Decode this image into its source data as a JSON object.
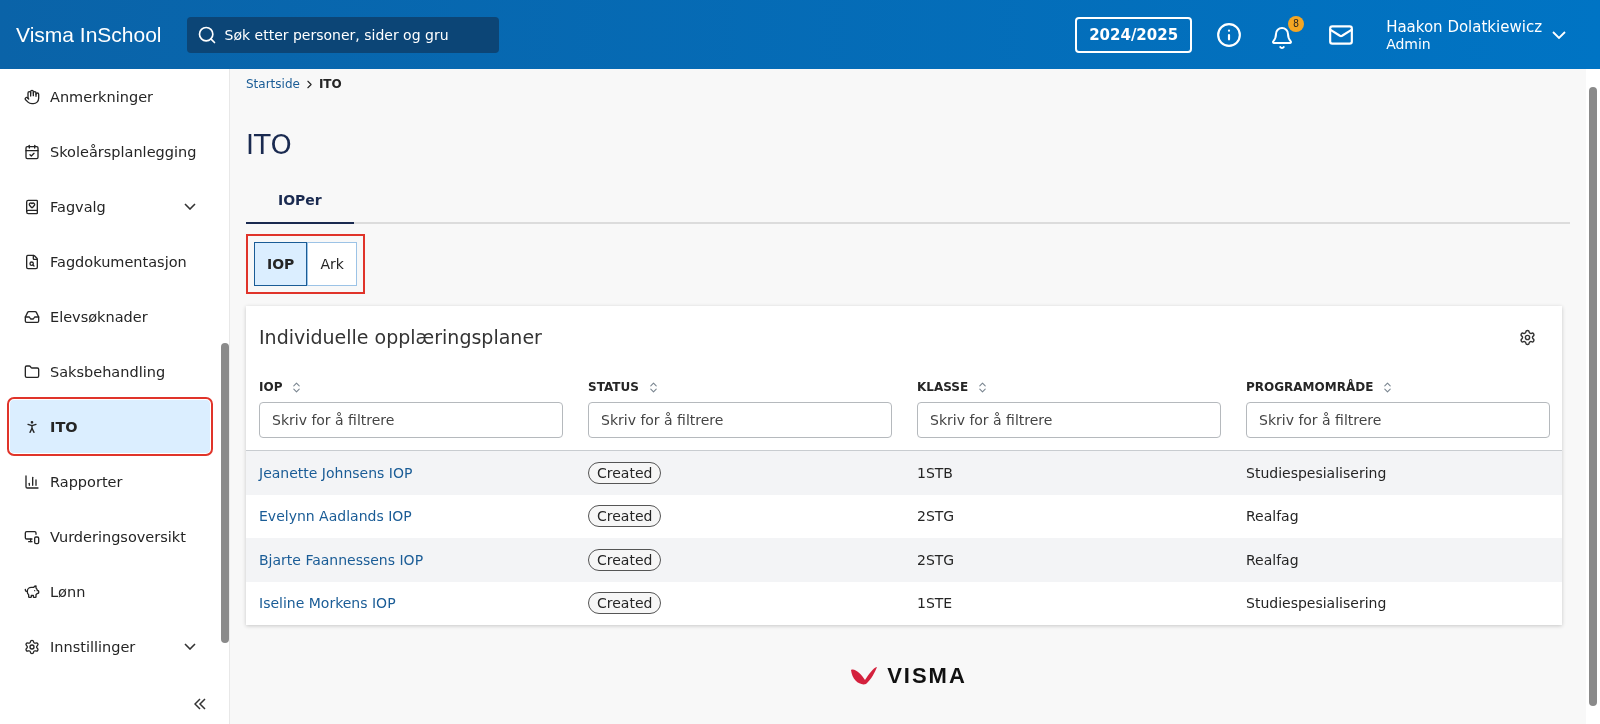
{
  "header": {
    "app_name": "Visma InSchool",
    "search": {
      "placeholder": "Søk etter personer, sider og gru"
    },
    "school_year": "2024/2025",
    "notification_count": "8",
    "user": {
      "name": "Haakon Dolatkiewicz",
      "role": "Admin"
    }
  },
  "sidebar": {
    "items": [
      {
        "kind": "hand",
        "label": "Anmerkninger",
        "selected": false,
        "expandable": false,
        "highlighted": false
      },
      {
        "kind": "calendar",
        "label": "Skoleårsplanlegging",
        "selected": false,
        "expandable": false,
        "highlighted": false
      },
      {
        "kind": "book",
        "label": "Fagvalg",
        "selected": false,
        "expandable": true,
        "highlighted": false
      },
      {
        "kind": "document",
        "label": "Fagdokumentasjon",
        "selected": false,
        "expandable": false,
        "highlighted": false
      },
      {
        "kind": "inbox",
        "label": "Elevsøknader",
        "selected": false,
        "expandable": false,
        "highlighted": false
      },
      {
        "kind": "folder",
        "label": "Saksbehandling",
        "selected": false,
        "expandable": false,
        "highlighted": false
      },
      {
        "kind": "person",
        "label": "ITO",
        "selected": true,
        "expandable": false,
        "highlighted": true
      },
      {
        "kind": "chart",
        "label": "Rapporter",
        "selected": false,
        "expandable": false,
        "highlighted": false
      },
      {
        "kind": "monitor",
        "label": "Vurderingsoversikt",
        "selected": false,
        "expandable": false,
        "highlighted": false
      },
      {
        "kind": "piggy",
        "label": "Lønn",
        "selected": false,
        "expandable": false,
        "highlighted": false
      },
      {
        "kind": "gear",
        "label": "Innstillinger",
        "selected": false,
        "expandable": true,
        "highlighted": false
      }
    ]
  },
  "breadcrumb": [
    "Startside",
    "ITO"
  ],
  "page_title": "ITO",
  "tabs": [
    {
      "label": "IOPer",
      "selected": true
    }
  ],
  "view_toggle": {
    "highlighted": true,
    "options": [
      {
        "label": "IOP",
        "selected": true
      },
      {
        "label": "Ark",
        "selected": false
      }
    ]
  },
  "table_card": {
    "title": "Individuelle opplæringsplaner",
    "columns": [
      {
        "label": "IOP",
        "filter_placeholder": "Skriv for å filtrere"
      },
      {
        "label": "STATUS",
        "filter_placeholder": "Skriv for å filtrere"
      },
      {
        "label": "KLASSE",
        "filter_placeholder": "Skriv for å filtrere"
      },
      {
        "label": "PROGRAMOMRÅDE",
        "filter_placeholder": "Skriv for å filtrere"
      }
    ],
    "rows": [
      {
        "iop": "Jeanette Johnsens IOP",
        "status": "Created",
        "klasse": "1STB",
        "programomrade": "Studiespesialisering"
      },
      {
        "iop": "Evelynn Aadlands IOP",
        "status": "Created",
        "klasse": "2STG",
        "programomrade": "Realfag"
      },
      {
        "iop": "Bjarte Faannessens IOP",
        "status": "Created",
        "klasse": "2STG",
        "programomrade": "Realfag"
      },
      {
        "iop": "Iseline Morkens IOP",
        "status": "Created",
        "klasse": "1STE",
        "programomrade": "Studiespesialisering"
      }
    ]
  },
  "footer": {
    "logo_text": "VISMA"
  }
}
